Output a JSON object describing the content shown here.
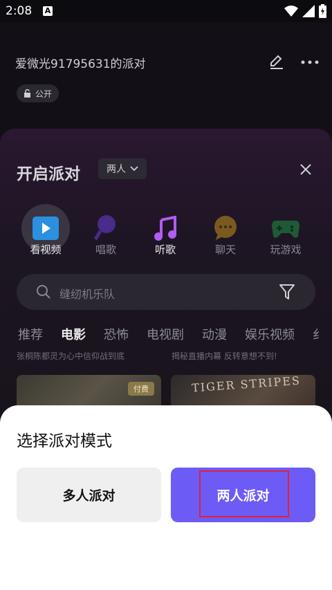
{
  "status_bar": {
    "time": "2:08",
    "notification_icon": "A"
  },
  "header": {
    "party_title": "爱微光91795631的派对",
    "public_label": "公开"
  },
  "panel": {
    "title": "开启派对",
    "mode_selected": "两人",
    "categories": [
      {
        "label": "看视频",
        "icon": "play-icon",
        "active": true
      },
      {
        "label": "唱歌",
        "icon": "microphone-icon",
        "active": false
      },
      {
        "label": "听歌",
        "icon": "music-note-icon",
        "active": true
      },
      {
        "label": "聊天",
        "icon": "chat-icon",
        "active": false
      },
      {
        "label": "玩游戏",
        "icon": "gamepad-icon",
        "active": false
      }
    ],
    "search_placeholder": "缝纫机乐队",
    "tabs": [
      "推荐",
      "电影",
      "恐怖",
      "电视剧",
      "动漫",
      "娱乐视频",
      "纟"
    ],
    "active_tab": "电影",
    "subtitles": [
      "张桐陈都灵为心中信仰战到底",
      "揭秘直播内幕 反转意想不到!"
    ],
    "cards": [
      {
        "badge": "付费"
      },
      {
        "art_text": "TIGER STRIPES"
      }
    ]
  },
  "sheet": {
    "title": "选择派对模式",
    "multi_button": "多人派对",
    "two_button": "两人派对"
  },
  "colors": {
    "accent": "#6c5cf5",
    "highlight_border": "#e0213a",
    "music_icon": "#b35cf0"
  }
}
